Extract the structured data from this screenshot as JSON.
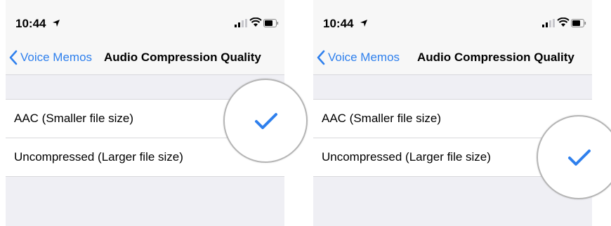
{
  "screens": [
    {
      "status": {
        "time": "10:44"
      },
      "nav": {
        "back_label": "Voice Memos",
        "title": "Audio Compression Quality"
      },
      "options": [
        {
          "label": "AAC (Smaller file size)",
          "selected": true
        },
        {
          "label": "Uncompressed (Larger file size)",
          "selected": false
        }
      ]
    },
    {
      "status": {
        "time": "10:44"
      },
      "nav": {
        "back_label": "Voice Memos",
        "title": "Audio Compression Quality"
      },
      "options": [
        {
          "label": "AAC (Smaller file size)",
          "selected": false
        },
        {
          "label": "Uncompressed (Larger file size)",
          "selected": true
        }
      ]
    }
  ],
  "colors": {
    "accent": "#2f80ed",
    "background": "#efeff4",
    "bar": "#f7f7f7"
  },
  "icons": [
    "location-arrow-icon",
    "signal-icon",
    "wifi-icon",
    "battery-icon",
    "back-chevron-icon",
    "checkmark-icon"
  ]
}
